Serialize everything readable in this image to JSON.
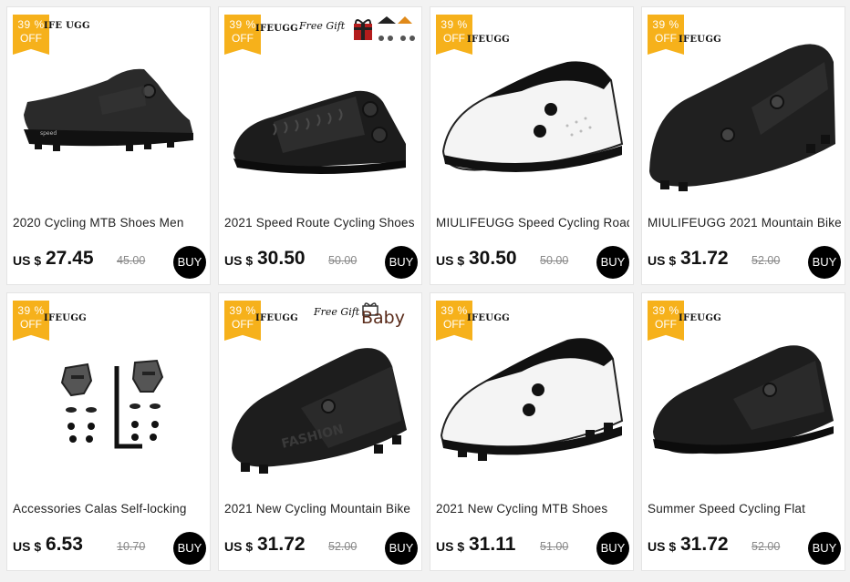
{
  "products": [
    {
      "badge_pct": "39 %",
      "badge_off": "OFF",
      "brand": "IFE UGG",
      "gift": "",
      "title": "2020 Cycling MTB Shoes Men",
      "currency": "US $",
      "price": "27.45",
      "old_price": "45.00",
      "buy": "BUY"
    },
    {
      "badge_pct": "39 %",
      "badge_off": "OFF",
      "brand": "IFEUGG",
      "gift": "Free Gift",
      "title": "2021 Speed Route Cycling Shoes",
      "currency": "US $",
      "price": "30.50",
      "old_price": "50.00",
      "buy": "BUY"
    },
    {
      "badge_pct": "39 %",
      "badge_off": "OFF",
      "brand": "IFEUGG",
      "gift": "",
      "title": "MIULIFEUGG Speed Cycling Road",
      "currency": "US $",
      "price": "30.50",
      "old_price": "50.00",
      "buy": "BUY"
    },
    {
      "badge_pct": "39 %",
      "badge_off": "OFF",
      "brand": "IFEUGG",
      "gift": "",
      "title": "MIULIFEUGG 2021 Mountain Bike",
      "currency": "US $",
      "price": "31.72",
      "old_price": "52.00",
      "buy": "BUY"
    },
    {
      "badge_pct": "39 %",
      "badge_off": "OFF",
      "brand": "IFEUGG",
      "gift": "",
      "title": "Accessories Calas Self-locking",
      "currency": "US $",
      "price": "6.53",
      "old_price": "10.70",
      "buy": "BUY"
    },
    {
      "badge_pct": "39 %",
      "badge_off": "OFF",
      "brand": "IFEUGG",
      "gift": "Free Gift",
      "baby": "Baby",
      "title": "2021 New Cycling Mountain Bike",
      "currency": "US $",
      "price": "31.72",
      "old_price": "52.00",
      "buy": "BUY"
    },
    {
      "badge_pct": "39 %",
      "badge_off": "OFF",
      "brand": "IFEUGG",
      "gift": "",
      "title": "2021 New Cycling MTB Shoes",
      "currency": "US $",
      "price": "31.11",
      "old_price": "51.00",
      "buy": "BUY"
    },
    {
      "badge_pct": "39 %",
      "badge_off": "OFF",
      "brand": "IFEUGG",
      "gift": "",
      "title": "Summer Speed Cycling Flat",
      "currency": "US $",
      "price": "31.72",
      "old_price": "52.00",
      "buy": "BUY"
    }
  ],
  "colors": {
    "badge": "#f6b11b",
    "buy_button": "#000000",
    "card_bg": "#ffffff",
    "page_bg": "#f2f2f2"
  },
  "icons": [
    "gift-box-icon",
    "shoe-image",
    "cleat-set-image"
  ]
}
